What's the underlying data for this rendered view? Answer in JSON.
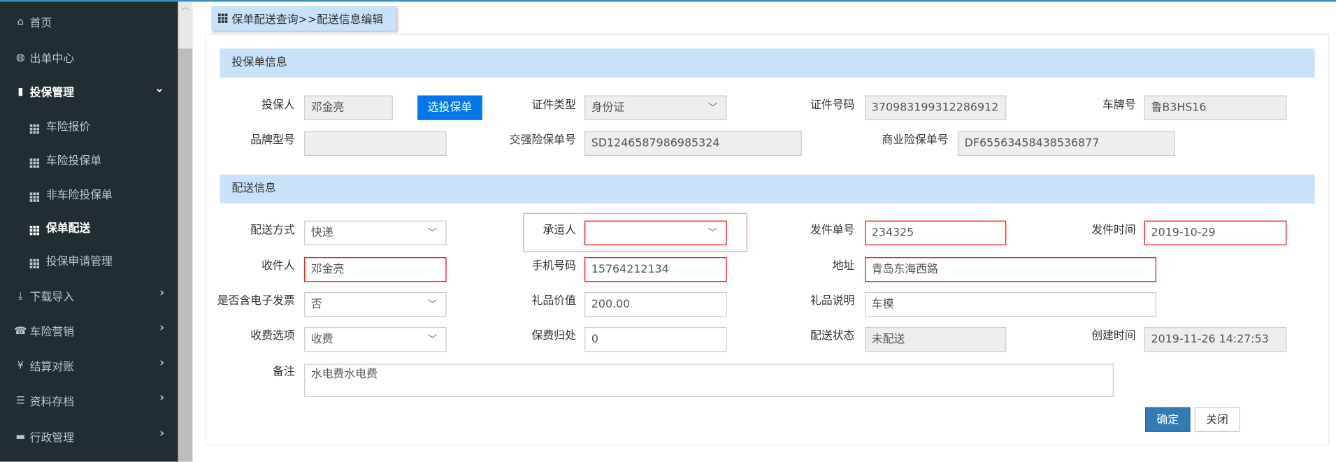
{
  "sidebar": {
    "items": [
      {
        "label": "首页",
        "icon": "home-icon",
        "glyph": "⌂"
      },
      {
        "label": "出单中心",
        "icon": "globe-icon",
        "glyph": "◍"
      },
      {
        "label": "投保管理",
        "icon": "file-icon",
        "glyph": "▮",
        "chevron": "⌄"
      },
      {
        "label": "车险报价",
        "icon": "grid-icon"
      },
      {
        "label": "车险投保单",
        "icon": "grid-icon"
      },
      {
        "label": "非车险投保单",
        "icon": "grid-icon"
      },
      {
        "label": "保单配送",
        "icon": "grid-icon"
      },
      {
        "label": "投保申请管理",
        "icon": "grid-icon"
      },
      {
        "label": "下载导入",
        "icon": "import-icon",
        "glyph": "⤓",
        "chevron": "›"
      },
      {
        "label": "车险营销",
        "icon": "phone-icon",
        "glyph": "☎",
        "chevron": "›"
      },
      {
        "label": "结算对账",
        "icon": "yen-icon",
        "glyph": "¥",
        "chevron": "›"
      },
      {
        "label": "资料存档",
        "icon": "list-icon",
        "glyph": "☰",
        "chevron": "›"
      },
      {
        "label": "行政管理",
        "icon": "briefcase-icon",
        "glyph": "▬",
        "chevron": "›"
      }
    ]
  },
  "breadcrumb": "保单配送查询>>配送信息编辑",
  "policy_section": {
    "title": "投保单信息",
    "applicant_label": "投保人",
    "applicant": "邓金亮",
    "select_policy_button": "选投保单",
    "id_type_label": "证件类型",
    "id_type": "身份证",
    "id_number_label": "证件号码",
    "id_number": "370983199312286912",
    "plate_label": "车牌号",
    "plate": "鲁B3HS16",
    "brand_label": "品牌型号",
    "brand": "",
    "compulsory_label": "交强险保单号",
    "compulsory": "SD1246587986985324",
    "commercial_label": "商业险保单号",
    "commercial": "DF65563458438536877"
  },
  "delivery_section": {
    "title": "配送信息",
    "method_label": "配送方式",
    "method": "快递",
    "carrier_label": "承运人",
    "carrier": "",
    "tracking_label": "发件单号",
    "tracking": "234325",
    "send_time_label": "发件时间",
    "send_time": "2019-10-29",
    "recipient_label": "收件人",
    "recipient": "邓金亮",
    "phone_label": "手机号码",
    "phone": "15764212134",
    "address_label": "地址",
    "address": "青岛东海西路",
    "einvoice_label": "是否含电子发票",
    "einvoice": "否",
    "gift_value_label": "礼品价值",
    "gift_value": "200.00",
    "gift_desc_label": "礼品说明",
    "gift_desc": "车模",
    "fee_label": "收费选项",
    "fee": "收费",
    "premium_label": "保费归处",
    "premium": "0",
    "status_label": "配送状态",
    "status": "未配送",
    "created_label": "创建时间",
    "created": "2019-11-26 14:27:53",
    "remark_label": "备注",
    "remark": "水电费水电费"
  },
  "actions": {
    "confirm": "确定",
    "close": "关闭"
  },
  "colors": {
    "sidebar": "#222d32",
    "section": "#c9e1f9",
    "primary": "#0078e7",
    "confirm": "#337ab7",
    "error": "#ff0000"
  }
}
